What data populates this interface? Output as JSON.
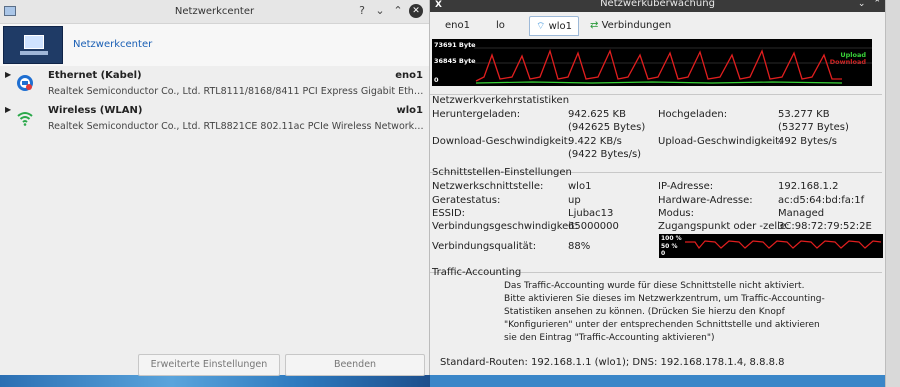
{
  "left": {
    "title": "Netzwerkcenter",
    "header_link": "Netzwerkcenter",
    "interfaces": [
      {
        "name": "Ethernet (Kabel)",
        "device": "eno1",
        "description": "Realtek Semiconductor Co., Ltd. RTL8111/8168/8411 PCI Express Gigabit Ethern...",
        "icon": "ethernet-icon"
      },
      {
        "name": "Wireless (WLAN)",
        "device": "wlo1",
        "description": "Realtek Semiconductor Co., Ltd. RTL8821CE 802.11ac PCIe Wireless Network Ad...",
        "icon": "wifi-icon"
      }
    ],
    "buttons": {
      "advanced": "Erweiterte Einstellungen",
      "quit": "Beenden"
    }
  },
  "right": {
    "title": "Netzwerküberwachung",
    "tabs": [
      "eno1",
      "lo",
      "wlo1",
      "Verbindungen"
    ],
    "active_tab": "wlo1",
    "graph": {
      "ylabel_top": "73691 Byte",
      "ylabel_mid": "36845 Byte",
      "ylabel_zero": "0",
      "legend_upload": "Upload",
      "legend_download": "Download"
    },
    "stats": {
      "title": "Netzwerkverkehrstatistiken",
      "down_label": "Heruntergeladen:",
      "down_value": "942.625 KB",
      "down_bytes": "(942625 Bytes)",
      "up_label": "Hochgeladen:",
      "up_value": "53.277 KB",
      "up_bytes": "(53277 Bytes)",
      "down_speed_label": "Download-Geschwindigkeit:",
      "down_speed_value": "9.422 KB/s",
      "down_speed_bytes": "(9422 Bytes/s)",
      "up_speed_label": "Upload-Geschwindigkeit:",
      "up_speed_value": "492 Bytes/s"
    },
    "iface": {
      "title": "Schnittstellen-Einstellungen",
      "iface_label": "Netzwerkschnittstelle:",
      "iface_value": "wlo1",
      "ip_label": "IP-Adresse:",
      "ip_value": "192.168.1.2",
      "state_label": "Geratestatus:",
      "state_value": "up",
      "hw_label": "Hardware-Adresse:",
      "hw_value": "ac:d5:64:bd:fa:1f",
      "essid_label": "ESSID:",
      "essid_value": "Ljubac13",
      "mode_label": "Modus:",
      "mode_value": "Managed",
      "speed_label": "Verbindungsgeschwindigkeit:",
      "speed_value": "65000000",
      "ap_label": "Zugangspunkt oder -zelle:",
      "ap_value": "3C:98:72:79:52:2E",
      "quality_label": "Verbindungsqualität:",
      "quality_value": "88%",
      "quality_graph_top": "100 %",
      "quality_graph_mid": "50 %",
      "quality_graph_zero": "0"
    },
    "accounting": {
      "title": "Traffic-Accounting",
      "lines": [
        "Das Traffic-Accounting wurde für diese Schnittstelle nicht aktiviert.",
        "Bitte aktivieren Sie dieses im Netzwerkzentrum, um Traffic-Accounting-",
        "Statistiken ansehen zu können. (Drücken Sie hierzu den Knopf",
        "\"Konfigurieren\" unter der entsprechenden Schnittstelle und aktivieren",
        "sie den Eintrag \"Traffic-Accounting aktivieren\")"
      ]
    },
    "status_bar": "Standard-Routen: 192.168.1.1 (wlo1); DNS: 192.168.178.1.4, 8.8.8.8"
  },
  "colors": {
    "upload": "#39d339",
    "download": "#e01e1e",
    "link": "#1a5fb4"
  }
}
